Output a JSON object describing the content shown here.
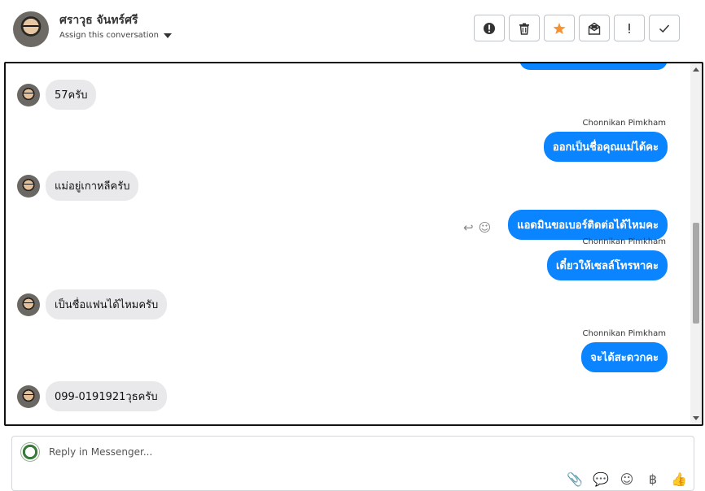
{
  "header": {
    "contact_name": "ศราวุธ จันทร์ศรี",
    "assign_label": "Assign this conversation",
    "actions": [
      {
        "name": "spam-button",
        "icon": "alert-circle-icon",
        "glyph": "❗"
      },
      {
        "name": "delete-button",
        "icon": "trash-icon",
        "glyph": "🗑"
      },
      {
        "name": "star-button",
        "icon": "star-icon",
        "glyph": "★"
      },
      {
        "name": "mark-unread-button",
        "icon": "envelope-icon",
        "glyph": "✉"
      },
      {
        "name": "important-button",
        "icon": "exclamation-icon",
        "glyph": "!"
      },
      {
        "name": "done-button",
        "icon": "check-icon",
        "glyph": "✓"
      }
    ]
  },
  "thread": {
    "messages": [
      {
        "type": "in",
        "text": "57ครับ"
      },
      {
        "type": "out",
        "sender": "Chonnikan Pimkham",
        "text": "ออกเป็นชื่อคุณแม่ได้คะ"
      },
      {
        "type": "in",
        "text": "แม่อยู่เกาหลีครับ"
      },
      {
        "type": "out",
        "text": "แอดมินขอเบอร์ติดต่อได้ไหมคะ"
      },
      {
        "type": "out",
        "sender": "Chonnikan Pimkham",
        "text": "เดี๋ยวให้เซลล์โทรหาคะ"
      },
      {
        "type": "in",
        "text": "เป็นชื่อแฟนได้ไหมครับ"
      },
      {
        "type": "out",
        "sender": "Chonnikan Pimkham",
        "text": "จะได้สะดวกคะ"
      },
      {
        "type": "in",
        "text": "099-0191921วุธครับ"
      }
    ]
  },
  "composer": {
    "placeholder": "Reply in Messenger...",
    "tools": [
      "paperclip-icon",
      "saved-reply-icon",
      "emoji-icon",
      "baht-icon",
      "thumbs-up-icon"
    ],
    "tool_glyphs": [
      "📎",
      "💬",
      "☺",
      "฿",
      "👍"
    ]
  },
  "colors": {
    "outgoing_bubble": "#0b84ff",
    "incoming_bubble": "#e9e9eb",
    "star_accent": "#f5922f"
  }
}
